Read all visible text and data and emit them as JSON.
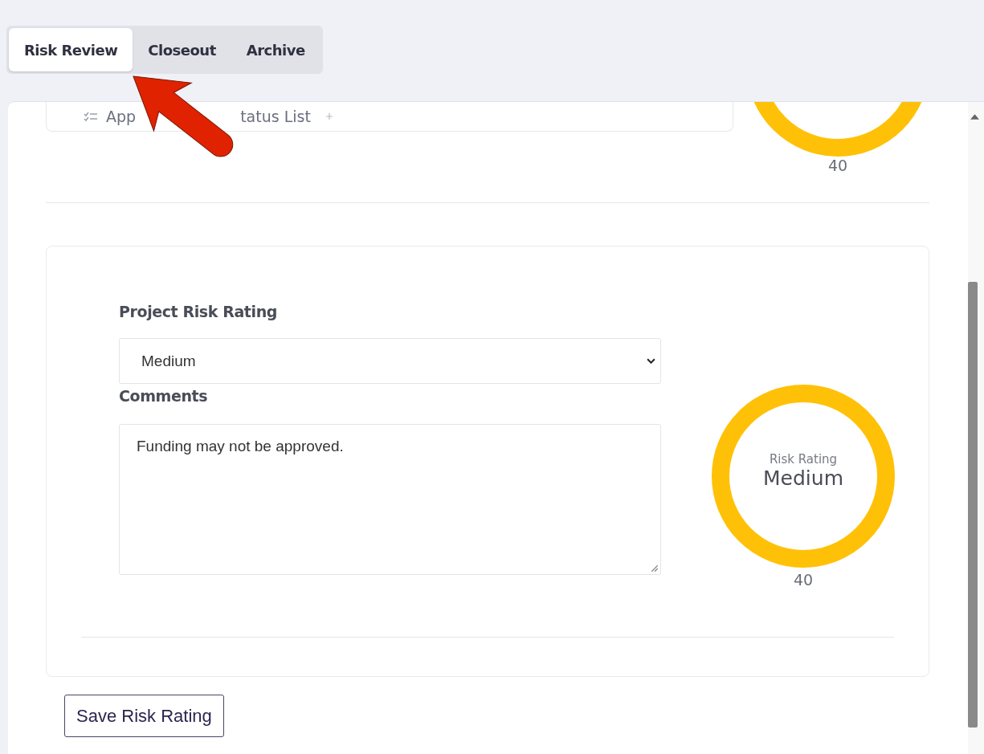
{
  "tabs": [
    {
      "label": "Risk Review",
      "selected": true
    },
    {
      "label": "Closeout",
      "selected": false
    },
    {
      "label": "Archive",
      "selected": false
    }
  ],
  "top_card": {
    "text_parts": [
      "App",
      "tatus List"
    ]
  },
  "top_gauge": {
    "value": "40"
  },
  "risk_form": {
    "rating_label": "Project Risk Rating",
    "rating_select": {
      "value": "Medium"
    },
    "comments_label": "Comments",
    "comments": {
      "value": "Funding may not be approved."
    },
    "gauge": {
      "title": "Risk Rating",
      "rating": "Medium",
      "value": "40"
    }
  },
  "save_button": "Save Risk Rating"
}
